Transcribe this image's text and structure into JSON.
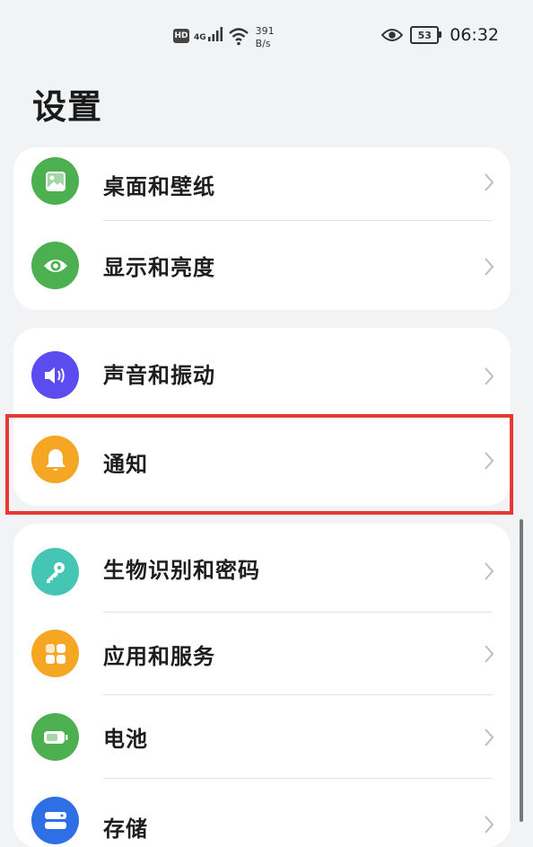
{
  "status_bar": {
    "hd": "HD",
    "network": "4G",
    "speed_value": "391",
    "speed_unit": "B/s",
    "battery": "53",
    "time": "06:32"
  },
  "page": {
    "title": "设置"
  },
  "groups": [
    {
      "items": [
        {
          "label": "桌面和壁纸",
          "icon": "wallpaper-icon",
          "color": "#4caf50"
        },
        {
          "label": "显示和亮度",
          "icon": "eye-icon",
          "color": "#4caf50"
        }
      ]
    },
    {
      "items": [
        {
          "label": "声音和振动",
          "icon": "speaker-icon",
          "color": "#5b4cf0"
        },
        {
          "label": "通知",
          "icon": "bell-icon",
          "color": "#f5a623"
        }
      ]
    },
    {
      "items": [
        {
          "label": "生物识别和密码",
          "icon": "key-icon",
          "color": "#45c6b4"
        },
        {
          "label": "应用和服务",
          "icon": "apps-grid-icon",
          "color": "#f5a623"
        },
        {
          "label": "电池",
          "icon": "battery-icon",
          "color": "#4caf50"
        },
        {
          "label": "存储",
          "icon": "storage-icon",
          "color": "#2f6fe6"
        }
      ]
    }
  ],
  "highlighted_item": "通知"
}
